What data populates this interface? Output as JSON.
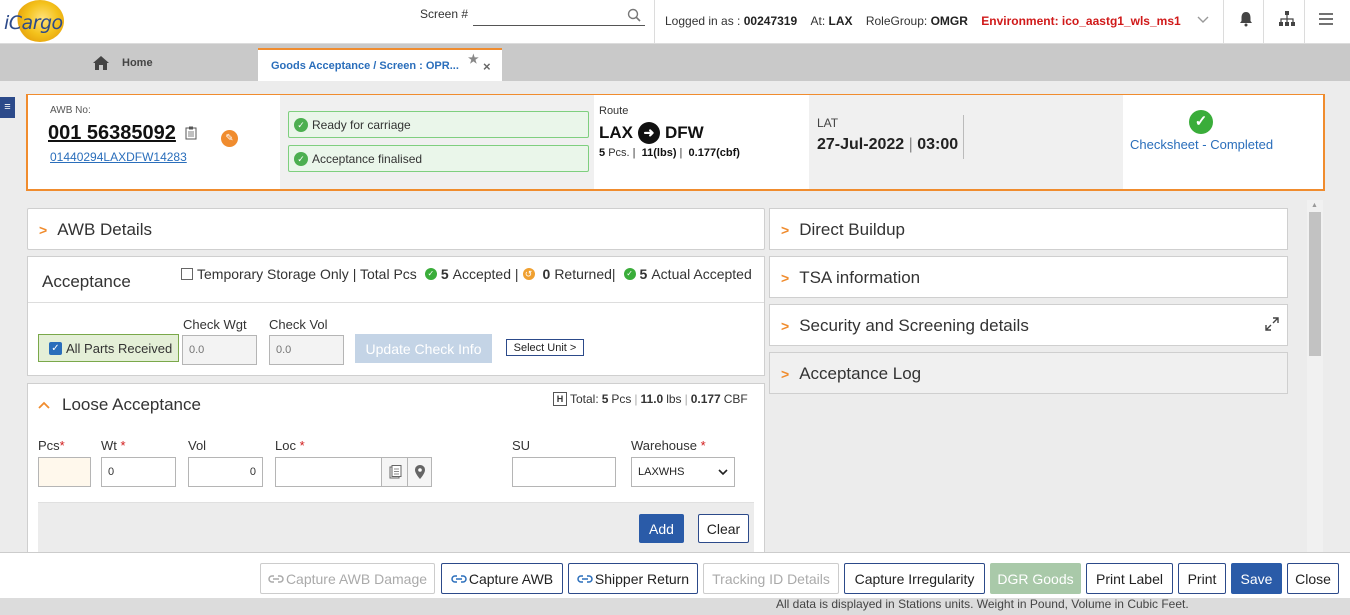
{
  "app": {
    "logo_text": "iCargo"
  },
  "topbar": {
    "screen_label": "Screen #",
    "screen_value": "",
    "logged_in_label": "Logged in as :",
    "user_id": "00247319",
    "at_label": "At:",
    "station": "LAX",
    "rolegroup_label": "RoleGroup:",
    "rolegroup": "OMGR",
    "environment": "Environment: ico_aastg1_wls_ms1"
  },
  "tabs": {
    "home_label": "Home",
    "active_label": "Goods Acceptance / Screen : OPR..."
  },
  "header": {
    "awb_label": "AWB No:",
    "awb_number": "001 56385092",
    "awb_link": "01440294LAXDFW14283",
    "status_1": "Ready for carriage",
    "status_2": "Acceptance finalised",
    "route_label": "Route",
    "origin": "LAX",
    "destination": "DFW",
    "pcs": "5",
    "pcs_unit": "Pcs.",
    "wgt": "11",
    "wgt_unit": "(lbs)",
    "vol": "0.177",
    "vol_unit": "(cbf)",
    "lat_label": "LAT",
    "lat_date": "27-Jul-2022",
    "lat_time": "03:00",
    "checksheet": "Checksheet - Completed"
  },
  "left": {
    "awb_details": "AWB Details",
    "acceptance_title": "Acceptance",
    "temp_storage": "Temporary Storage Only",
    "total_pcs_label": "| Total Pcs",
    "accepted_count": "5",
    "accepted_label": "Accepted |",
    "returned_count": "0",
    "returned_label": "Returned|",
    "actual_count": "5",
    "actual_label": "Actual Accepted",
    "all_parts": "All Parts Received",
    "check_wgt_label": "Check Wgt",
    "check_wgt_placeholder": "0.0",
    "check_vol_label": "Check Vol",
    "check_vol_placeholder": "0.0",
    "update_check": "Update Check Info",
    "select_unit": "Select Unit >",
    "loose_title": "Loose Acceptance",
    "loose_total_label": "Total:",
    "loose_pcs": "5",
    "loose_pcs_unit": "Pcs",
    "loose_wt": "11.0",
    "loose_wt_unit": "lbs",
    "loose_vol": "0.177",
    "loose_vol_unit": "CBF",
    "pcs_label": "Pcs",
    "wt_label": "Wt",
    "vol_label": "Vol",
    "loc_label": "Loc",
    "su_label": "SU",
    "warehouse_label": "Warehouse",
    "wt_value": "0",
    "vol_value": "0",
    "warehouse_value": "LAXWHS",
    "add": "Add",
    "clear": "Clear"
  },
  "right": {
    "direct_buildup": "Direct Buildup",
    "tsa": "TSA information",
    "security": "Security and Screening details",
    "acceptance_log": "Acceptance Log"
  },
  "footer": {
    "capture_awb_damage": "Capture AWB Damage",
    "capture_awb": "Capture AWB",
    "shipper_return": "Shipper Return",
    "tracking_id": "Tracking ID Details",
    "capture_irregularity": "Capture Irregularity",
    "dgr_goods": "DGR Goods",
    "print_label": "Print Label",
    "print": "Print",
    "save": "Save",
    "close": "Close",
    "footnote": "All data is displayed in Stations units. Weight in Pound, Volume in Cubic Feet."
  },
  "colors": {
    "accent": "#f08c2e",
    "brand": "#2c4a8a",
    "link": "#2a6ebb",
    "env": "#d01919",
    "success": "#4caf50"
  }
}
